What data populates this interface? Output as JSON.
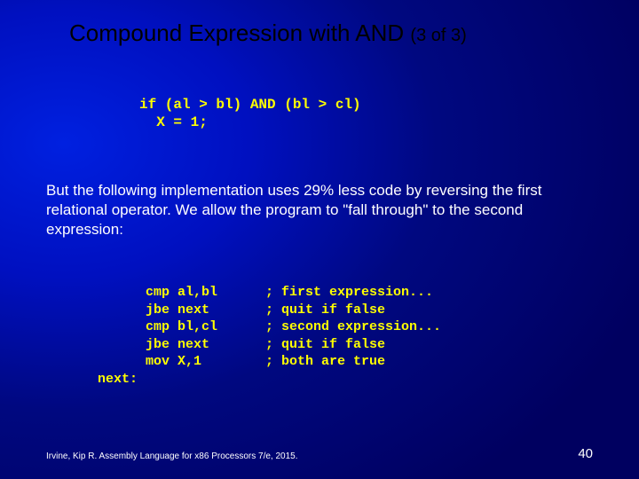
{
  "title_main": "Compound Expression with AND",
  "title_sub": "(3 of 3)",
  "code_top": "if (al > bl) AND (bl > cl)\n  X = 1;",
  "paragraph": "But the following implementation uses  29% less code by reversing the first relational operator. We allow the program to \"fall through\" to the second expression:",
  "code_bottom": "      cmp al,bl      ; first expression...\n      jbe next       ; quit if false\n      cmp bl,cl      ; second expression...\n      jbe next       ; quit if false\n      mov X,1        ; both are true\nnext:",
  "footer": "Irvine, Kip R. Assembly Language for x86 Processors 7/e, 2015.",
  "page_number": "40"
}
